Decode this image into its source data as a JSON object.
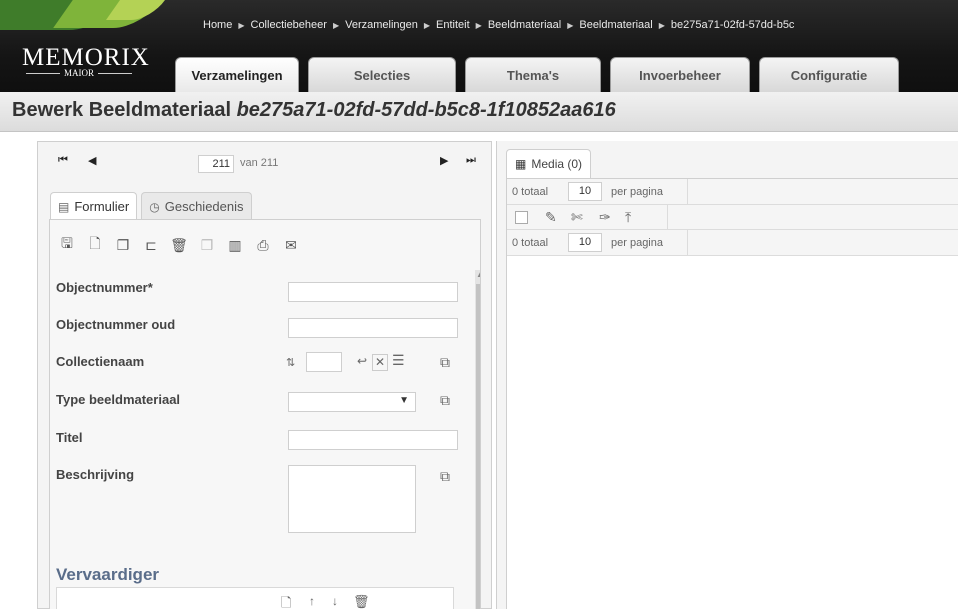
{
  "breadcrumb": [
    "Home",
    "Collectiebeheer",
    "Verzamelingen",
    "Entiteit",
    "Beeldmateriaal",
    "Beeldmateriaal",
    "be275a71-02fd-57dd-b5c"
  ],
  "brand": {
    "name": "MEMORIX",
    "sub": "MAIOR"
  },
  "main_tabs": [
    {
      "label": "Verzamelingen",
      "active": true
    },
    {
      "label": "Selecties"
    },
    {
      "label": "Thema's"
    },
    {
      "label": "Invoerbeheer"
    },
    {
      "label": "Configuratie"
    }
  ],
  "title": {
    "prefix": "Bewerk Beeldmateriaal",
    "id": "be275a71-02fd-57dd-b5c8-1f10852aa616"
  },
  "pager": {
    "current": "211",
    "total": "van 211"
  },
  "sub_tabs": [
    {
      "label": "Formulier",
      "icon": "form-icon",
      "active": true
    },
    {
      "label": "Geschiedenis",
      "icon": "clock-icon"
    }
  ],
  "fields": [
    {
      "label": "Objectnummer*"
    },
    {
      "label": "Objectnummer oud"
    },
    {
      "label": "Collectienaam"
    },
    {
      "label": "Type beeldmateriaal",
      "value": ""
    },
    {
      "label": "Titel"
    },
    {
      "label": "Beschrijving"
    }
  ],
  "section": {
    "heading": "Vervaardiger"
  },
  "media": {
    "tab_label": "Media (0)",
    "top": {
      "total": "0 totaal",
      "per_page_value": "10",
      "per_page_label": "per pagina"
    },
    "bottom": {
      "total": "0 totaal",
      "per_page_value": "10",
      "per_page_label": "per pagina"
    }
  }
}
